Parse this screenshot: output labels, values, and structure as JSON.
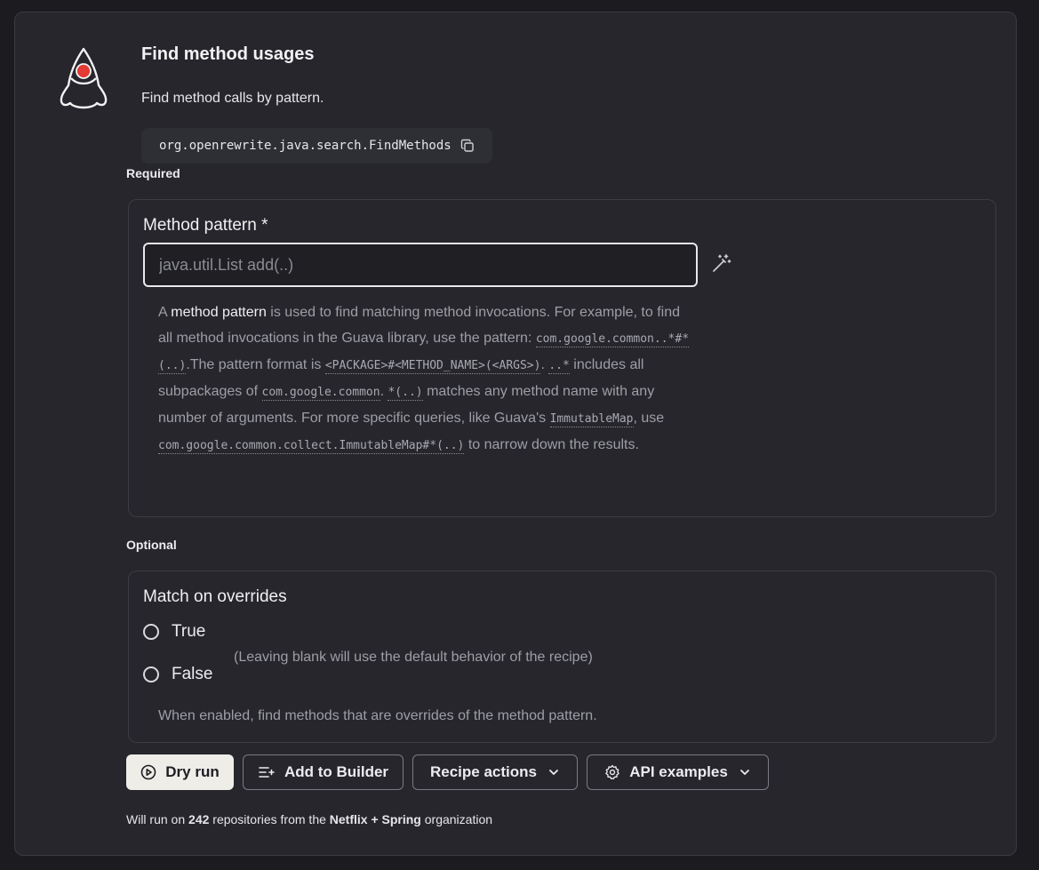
{
  "recipe": {
    "title": "Find method usages",
    "description": "Find method calls by pattern.",
    "id": "org.openrewrite.java.search.FindMethods"
  },
  "colors": {
    "background": "#1b1b20",
    "card": "#26262c",
    "primary_button": "#efede8",
    "logo_dot": "#e23b36"
  },
  "icons": {
    "logo": "duke-logo-icon",
    "copy": "copy-icon",
    "wand": "magic-wand-icon",
    "play": "play-circle-icon",
    "builder": "add-list-icon",
    "chevron": "chevron-down-icon",
    "gear": "gear-icon"
  },
  "required": {
    "section_label": "Required",
    "field_label": "Method pattern *",
    "placeholder": "java.util.List add(..)",
    "help": {
      "p1": "A ",
      "p1_hl": "method pattern",
      "p2": " is used to find matching method invocations. For example, to find all method invocations in the Guava library, use the pattern: ",
      "c1": "com.google.common..*#*(..)",
      "p3": ".The pattern format is ",
      "c2": "<PACKAGE>#<METHOD_NAME>(<ARGS>)",
      "p4": ". ",
      "c3": "..*",
      "p5": " includes all subpackages of ",
      "c4": "com.google.common",
      "p6": ". ",
      "c5": "*(..)",
      "p7": " matches any method name with any number of arguments. For more specific queries, like Guava's ",
      "c6": "ImmutableMap",
      "p8": ", use ",
      "c7": "com.google.common.collect.ImmutableMap#*(..)",
      "p9": " to narrow down the results."
    }
  },
  "optional": {
    "section_label": "Optional",
    "field_label": "Match on overrides",
    "options": [
      "True",
      "False"
    ],
    "inline_hint": "(Leaving blank will use the default behavior of the recipe)",
    "description": "When enabled, find methods that are overrides of the method pattern."
  },
  "actions": {
    "dry_run": "Dry run",
    "add_to_builder": "Add to Builder",
    "recipe_actions": "Recipe actions",
    "api_examples": "API examples"
  },
  "footer": {
    "prefix": "Will run on ",
    "count": "242",
    "middle": " repositories from the ",
    "org": "Netflix + Spring",
    "suffix": " organization"
  }
}
